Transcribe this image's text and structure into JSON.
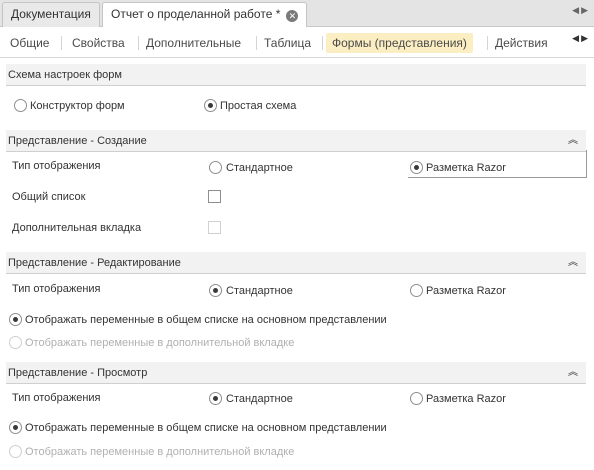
{
  "doc_tabs": [
    {
      "label": "Документация"
    },
    {
      "label": "Отчет о проделанной работе *"
    }
  ],
  "page_tabs": [
    {
      "label": "Общие"
    },
    {
      "label": "Свойства"
    },
    {
      "label": "Дополнительные"
    },
    {
      "label": "Таблица"
    },
    {
      "label": "Формы (представления)",
      "active": true
    },
    {
      "label": "Действия"
    }
  ],
  "schema": {
    "title": "Схема настроек форм",
    "option_constructor": "Конструктор форм",
    "option_simple": "Простая схема",
    "selected": "Простая схема"
  },
  "create_section": {
    "title": "Представление - Создание",
    "display_type_label": "Тип отображения",
    "option_standard": "Стандартное",
    "option_razor": "Разметка Razor",
    "selected": "Разметка Razor",
    "common_list_label": "Общий список",
    "common_list_checked": false,
    "extra_tab_label": "Дополнительная вкладка",
    "extra_tab_checked": false
  },
  "edit_section": {
    "title": "Представление - Редактирование",
    "display_type_label": "Тип отображения",
    "option_standard": "Стандартное",
    "option_razor": "Разметка Razor",
    "selected": "Стандартное",
    "vars_common": "Отображать переменные в общем списке на основном представлении",
    "vars_extra": "Отображать переменные в дополнительной вкладке"
  },
  "view_section": {
    "title": "Представление - Просмотр",
    "display_type_label": "Тип отображения",
    "option_standard": "Стандартное",
    "option_razor": "Разметка Razor",
    "selected": "Стандартное",
    "vars_common": "Отображать переменные в общем списке на основном представлении",
    "vars_extra": "Отображать переменные в дополнительной вкладке"
  }
}
